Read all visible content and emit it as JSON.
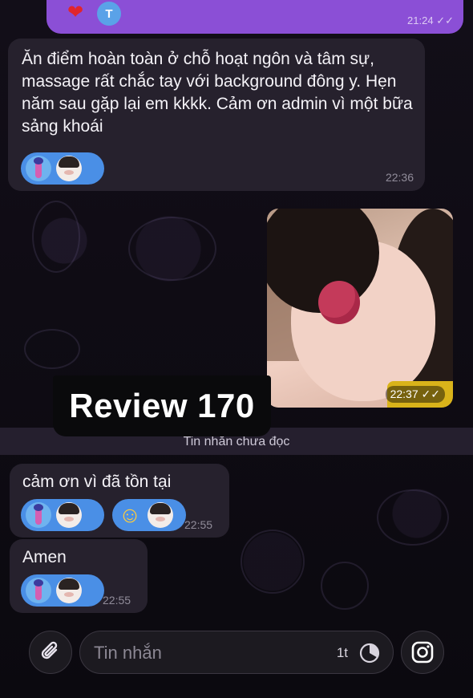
{
  "outgoing_top": {
    "reactions": [
      {
        "icon": "heart-icon",
        "color": "#e1252c"
      },
      {
        "icon": "avatar-initial",
        "letter": "T",
        "color": "#5aa2e8"
      }
    ],
    "time": "21:24",
    "status": "read-double-check"
  },
  "messages": [
    {
      "text": "Ăn điểm hoàn toàn ở chỗ hoạt ngôn và tâm sự, massage rất chắc tay với background đông y. Hẹn năm sau gặp lại em kkkk. Cảm ơn admin vì một bữa sảng khoái",
      "time": "22:36"
    },
    {
      "type": "image",
      "time": "22:37",
      "status": "read-double-check"
    },
    {
      "text": "cảm ơn vì đã tồn tại",
      "time": "22:55"
    },
    {
      "text": "Amen",
      "time": "22:55"
    }
  ],
  "overlay_label": "Review 170",
  "unread_divider": "Tin nhắn chưa đọc",
  "composer": {
    "placeholder": "Tin nhắn",
    "timer_label": "1t",
    "attach_icon": "paperclip-icon",
    "timer_icon": "timer-icon",
    "camera_icon": "instagram-camera-icon"
  },
  "colors": {
    "outgoing_bubble": "#8b4fd6",
    "incoming_bubble": "#26212d",
    "reaction_pill": "#4a8fe6",
    "background": "#0e0b12"
  }
}
